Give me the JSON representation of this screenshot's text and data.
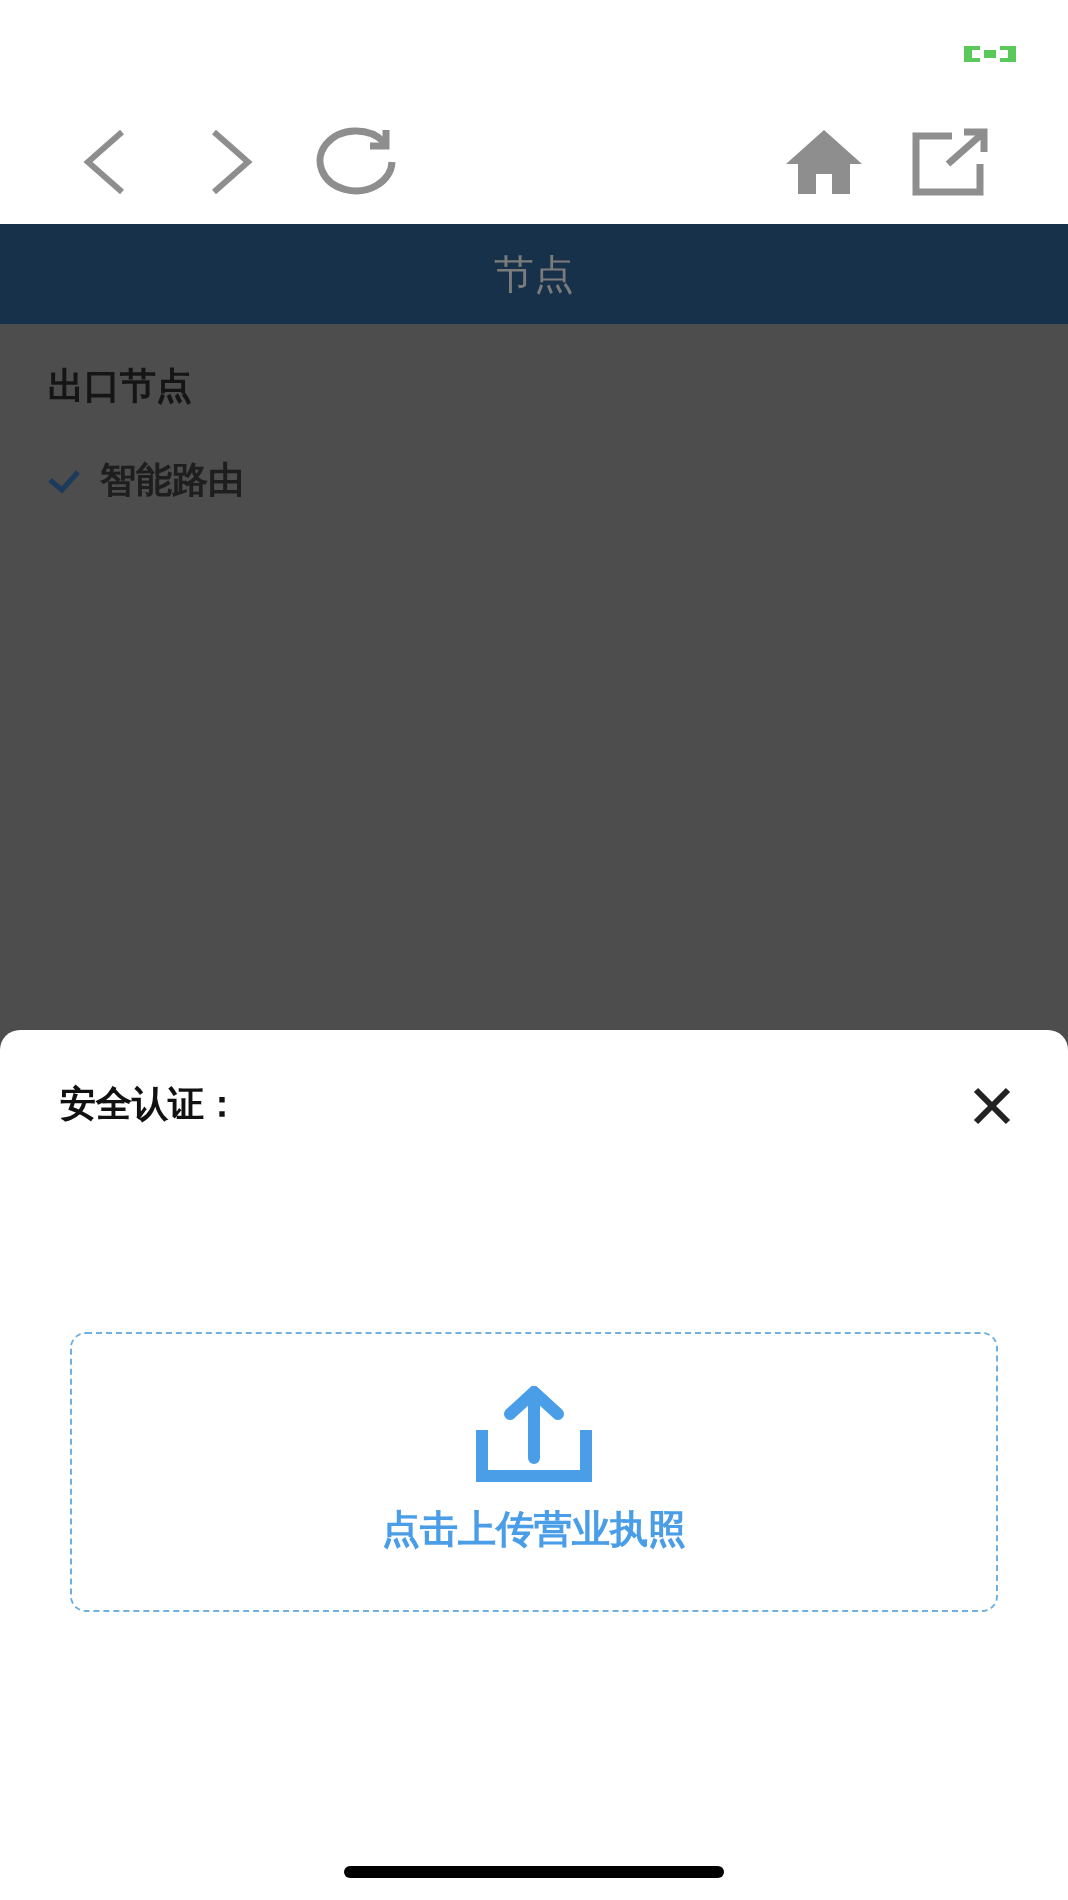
{
  "header": {
    "title": "节点"
  },
  "section": {
    "title": "出口节点",
    "options": [
      {
        "label": "智能路由",
        "selected": true
      }
    ]
  },
  "sheet": {
    "title": "安全认证：",
    "upload": {
      "label": "点击上传营业执照"
    }
  }
}
